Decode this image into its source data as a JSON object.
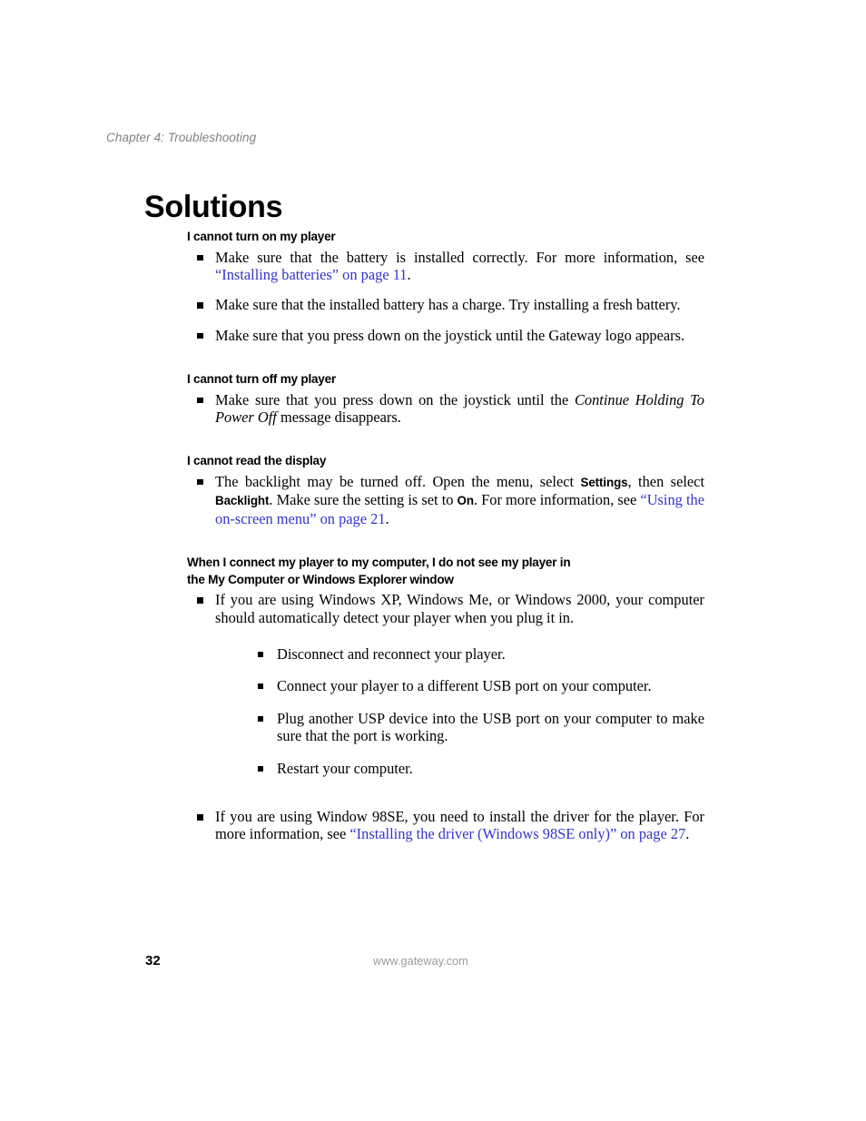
{
  "header": {
    "chapter": "Chapter 4: Troubleshooting"
  },
  "title": "Solutions",
  "sections": [
    {
      "heading": "I cannot turn on my player",
      "items": [
        {
          "lead": "Make sure that the battery is installed correctly. For more information, see ",
          "link": "“Installing batteries” on page 11",
          "tail": "."
        },
        {
          "lead": "Make sure that the installed battery has a charge. Try installing a fresh battery."
        },
        {
          "lead": "Make sure that you press down on the joystick until the Gateway logo appears."
        }
      ]
    },
    {
      "heading": "I cannot turn off my player",
      "items": [
        {
          "lead": "Make sure that you press down on the joystick until the ",
          "italic": "Continue Holding To Power Off",
          "tail": " message disappears."
        }
      ]
    },
    {
      "heading": "I cannot read the display",
      "items": [
        {
          "lead": "The backlight may be turned off. Open the menu, select ",
          "ui_term_1": "Settings",
          "mid_1": ", then select ",
          "ui_term_2": "Backlight",
          "mid_2": ". Make sure the setting is set to ",
          "ui_term_3": "On",
          "mid_3": ". For more information, see ",
          "link": "“Using the on-screen menu” on page 21",
          "tail": "."
        }
      ]
    },
    {
      "heading_line_1": "When I connect my player to my computer, I do not see my player in",
      "heading_line_2": "the My Computer or Windows Explorer window",
      "items": [
        {
          "lead": "If you are using Windows XP, Windows Me, or Windows 2000, your computer should automatically detect your player when you plug it in.",
          "subitems": [
            "Disconnect and reconnect your player.",
            "Connect your player to a different USB port on your computer.",
            "Plug another USP device into the USB port on your computer to make sure that the port is working.",
            "Restart your computer."
          ]
        },
        {
          "lead": "If you are using Window 98SE, you need to install the driver for the player. For more information, see ",
          "link": "“Installing the driver (Windows 98SE only)” on page 27",
          "tail": "."
        }
      ]
    }
  ],
  "footer": {
    "page_number": "32",
    "url": "www.gateway.com"
  },
  "colors": {
    "link": "#3333cc",
    "header_gray": "#808080",
    "footer_gray": "#9a9a9a"
  }
}
